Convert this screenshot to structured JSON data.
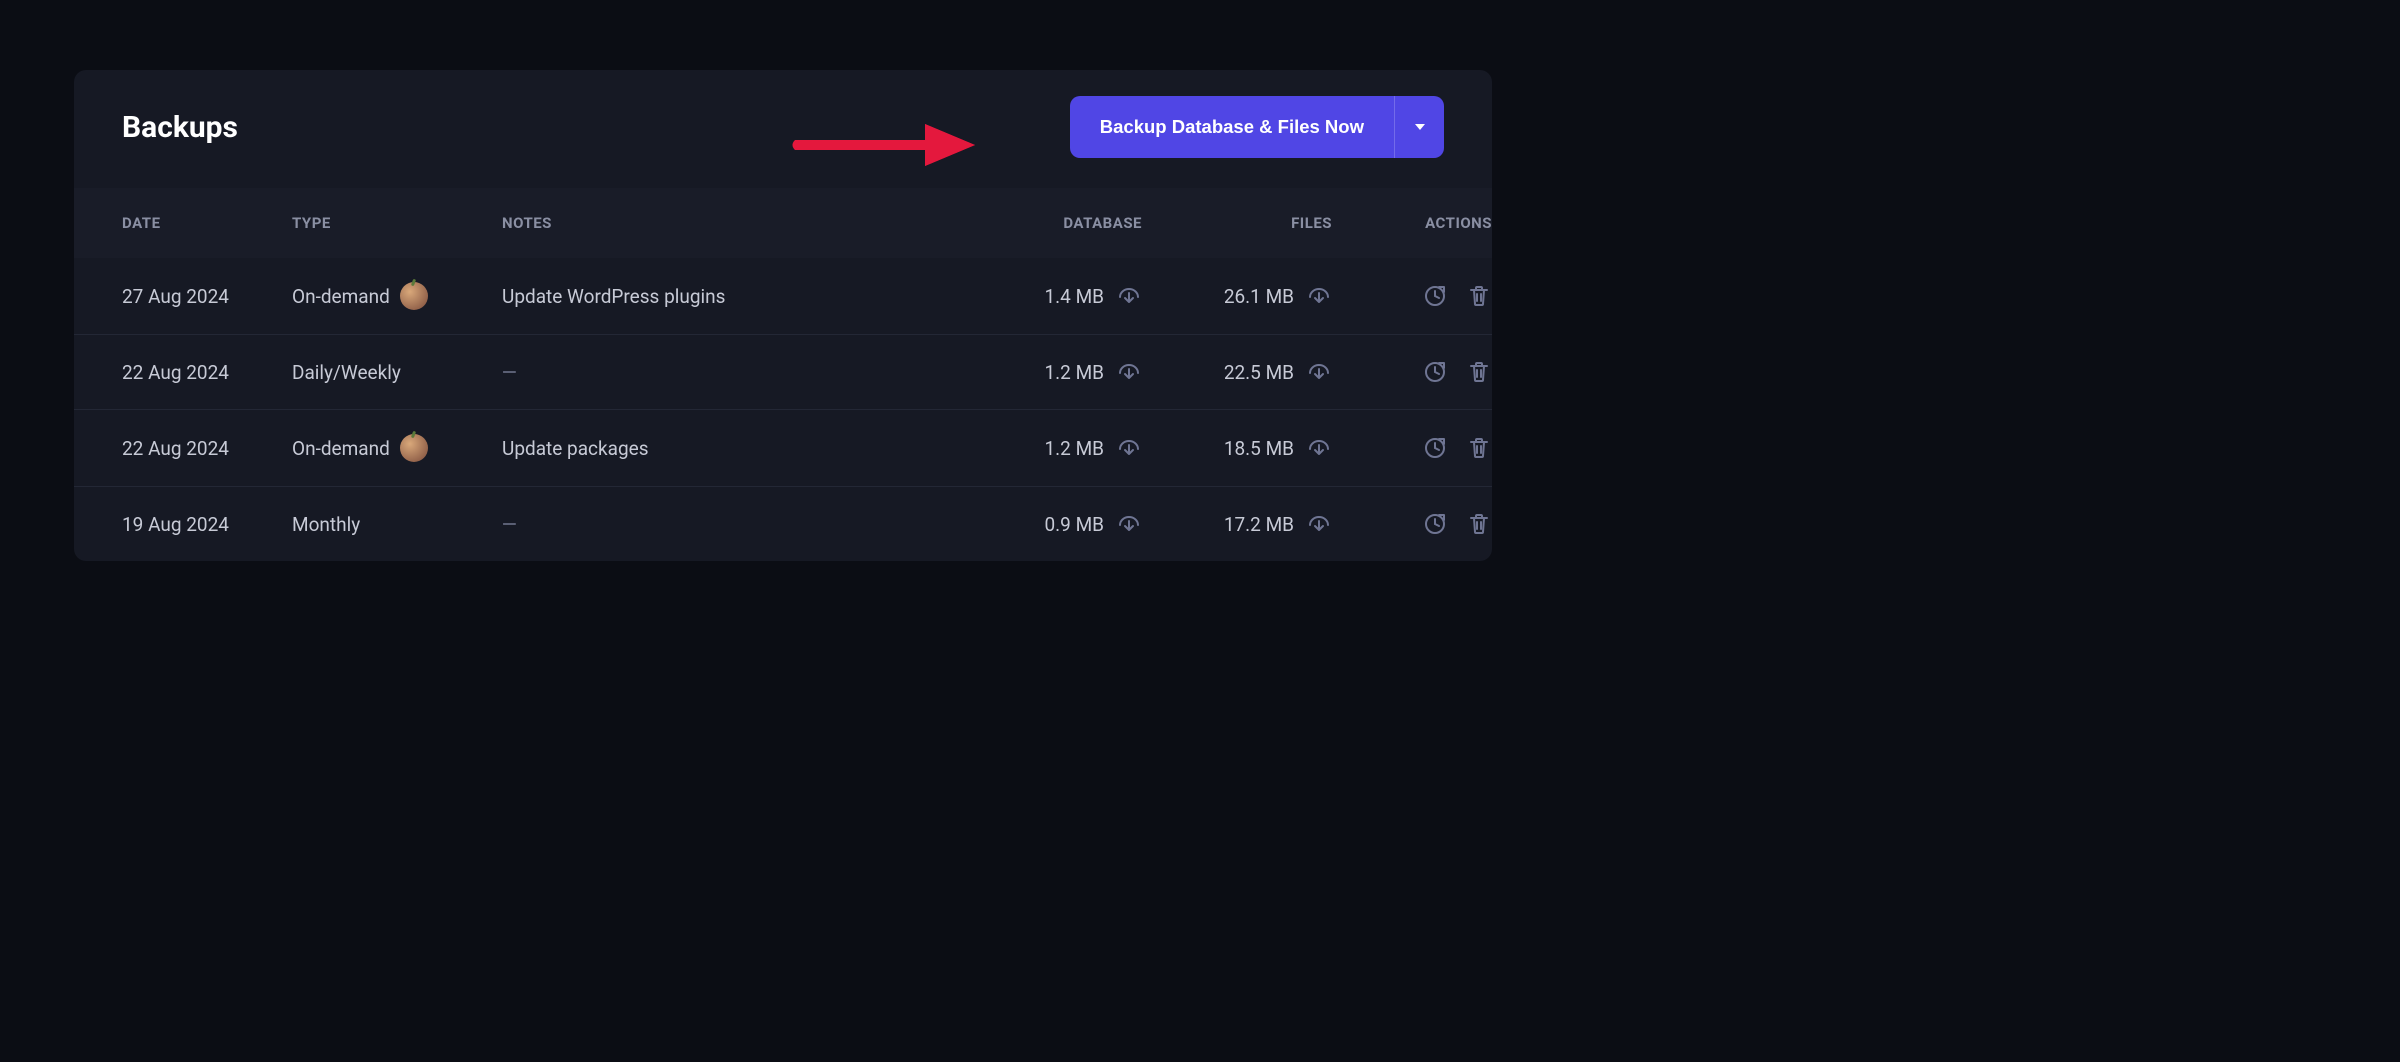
{
  "header": {
    "title": "Backups",
    "backup_button": "Backup Database & Files Now"
  },
  "columns": {
    "date": "DATE",
    "type": "TYPE",
    "notes": "NOTES",
    "database": "DATABASE",
    "files": "FILES",
    "actions": "ACTIONS"
  },
  "rows": [
    {
      "date": "27 Aug 2024",
      "type": "On-demand",
      "has_avatar": true,
      "notes": "Update WordPress plugins",
      "db": "1.4 MB",
      "files": "26.1 MB"
    },
    {
      "date": "22 Aug 2024",
      "type": "Daily/Weekly",
      "has_avatar": false,
      "notes": "—",
      "db": "1.2 MB",
      "files": "22.5 MB"
    },
    {
      "date": "22 Aug 2024",
      "type": "On-demand",
      "has_avatar": true,
      "notes": "Update packages",
      "db": "1.2 MB",
      "files": "18.5 MB"
    },
    {
      "date": "19 Aug 2024",
      "type": "Monthly",
      "has_avatar": false,
      "notes": "—",
      "db": "0.9 MB",
      "files": "17.2 MB"
    }
  ]
}
